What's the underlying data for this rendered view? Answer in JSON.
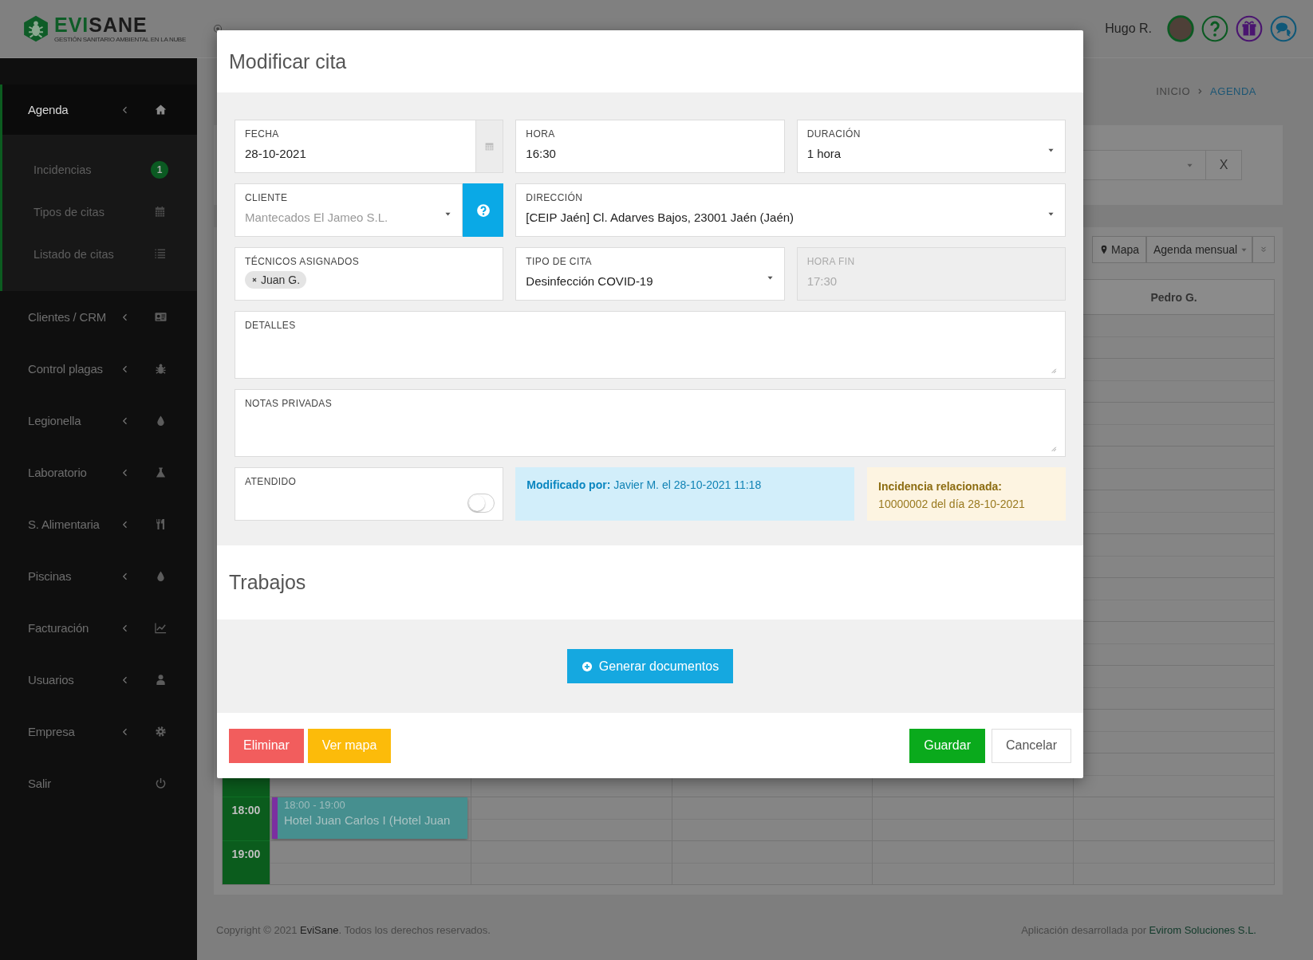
{
  "header": {
    "logo": "**EVI**SANE",
    "tagline": "GESTIÓN SANITARIO AMBIENTAL EN LA NUBE",
    "user_name": "Hugo R."
  },
  "sidebar": {
    "items": [
      {
        "label": "Agenda",
        "expanded": true,
        "children": [
          {
            "label": "Incidencias",
            "badge": "1"
          },
          {
            "label": "Tipos de citas"
          },
          {
            "label": "Listado de citas"
          }
        ]
      },
      {
        "label": "Clientes / CRM",
        "expanded": false
      },
      {
        "label": "Control plagas",
        "expanded": false
      },
      {
        "label": "Legionella",
        "expanded": false
      },
      {
        "label": "Laboratorio",
        "expanded": false
      },
      {
        "label": "S. Alimentaria",
        "expanded": false
      },
      {
        "label": "Piscinas",
        "expanded": false
      },
      {
        "label": "Facturación",
        "expanded": false
      },
      {
        "label": "Usuarios",
        "expanded": false
      },
      {
        "label": "Empresa",
        "expanded": false
      },
      {
        "label": "Salir"
      }
    ]
  },
  "breadcrumb": [
    {
      "label": "INICIO",
      "selected": false
    },
    {
      "label": "AGENDA",
      "selected": true
    }
  ],
  "filter": {
    "clear_button": "X"
  },
  "toolbar": {
    "map_button": "Mapa",
    "view_select": "Agenda mensual"
  },
  "calendar": {
    "columns": [
      {
        "label": "Pedro G."
      }
    ],
    "slots": [
      {
        "time": "18:00",
        "events": [
          {
            "time": "18:00 - 19:00",
            "title": "Hotel Juan Carlos I (Hotel Juan",
            "color": "#7b2fa0"
          }
        ]
      },
      {
        "time": "19:00"
      }
    ]
  },
  "footer": {
    "copyright": "Copyright © 2021 **EviSane**. Todos los derechos reservados.",
    "credits": "Aplicación desarrollada por **Evirom Soluciones S.L.**"
  },
  "modal": {
    "title": "Modificar cita",
    "fields": [
      {
        "kind": "date",
        "label": "FECHA",
        "value": "28-10-2021"
      },
      {
        "kind": "text",
        "label": "HORA",
        "value": "16:30",
        "disabled": false
      },
      {
        "kind": "select",
        "label": "DURACIÓN",
        "value": "1 hora",
        "wide": false
      },
      {
        "kind": "client",
        "label": "CLIENTE",
        "value": "Mantecados El Jameo S.L."
      },
      {
        "kind": "select",
        "label": "DIRECCIÓN",
        "value": "[CEIP Jaén] Cl. Adarves Bajos, 23001 Jaén (Jaén)",
        "wide": true
      },
      {
        "kind": "tags",
        "label": "TÉCNICOS ASIGNADOS",
        "tags": [
          "Juan G."
        ]
      },
      {
        "kind": "select",
        "label": "TIPO DE CITA",
        "value": "Desinfección COVID-19",
        "wide": false
      },
      {
        "kind": "text",
        "label": "HORA FIN",
        "value": "17:30",
        "disabled": true
      },
      {
        "kind": "textarea",
        "label": "DETALLES"
      },
      {
        "kind": "textarea",
        "label": "NOTAS PRIVADAS"
      },
      {
        "kind": "toggle",
        "label": "ATENDIDO",
        "on": false
      },
      {
        "kind": "info",
        "text": "**Modificado por:** Javier M. el 28-10-2021 11:18"
      },
      {
        "kind": "warning",
        "title": "Incidencia relacionada:",
        "text": "10000002 del día 28-10-2021"
      }
    ],
    "works_title": "Trabajos",
    "generate_button": "Generar documentos",
    "left_buttons": [
      {
        "label": "Eliminar",
        "kind": "danger"
      },
      {
        "label": "Ver mapa",
        "kind": "warning"
      }
    ],
    "right_buttons": [
      {
        "label": "Guardar",
        "kind": "success"
      },
      {
        "label": "Cancelar",
        "kind": "default"
      }
    ]
  }
}
